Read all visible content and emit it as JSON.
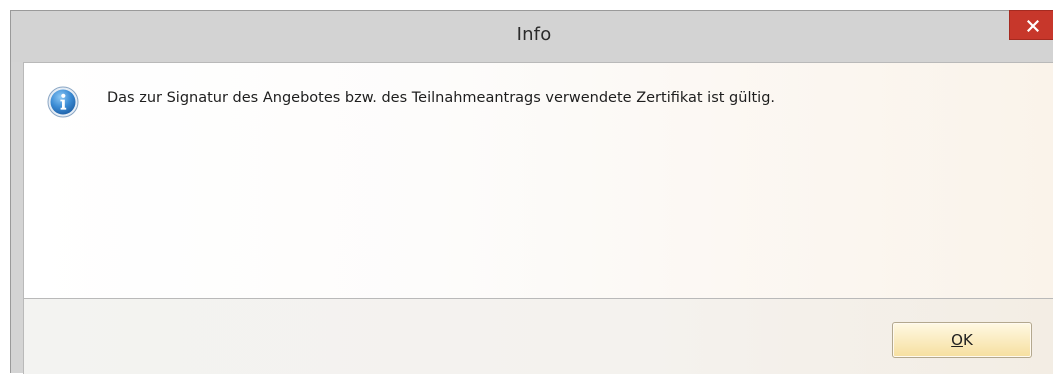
{
  "window": {
    "title": "Info",
    "close_symbol": "×",
    "close_icon": "close-icon"
  },
  "message": {
    "icon": "info-icon",
    "text": "Das zur Signatur des Angebotes bzw. des Teilnahmeantrags verwendete Zertifikat ist gültig."
  },
  "footer": {
    "ok_mnemonic": "O",
    "ok_rest": "K"
  },
  "colors": {
    "close_button": "#c7372b",
    "ok_button": "#fbedc4",
    "info_icon": "#2f7fc9"
  }
}
